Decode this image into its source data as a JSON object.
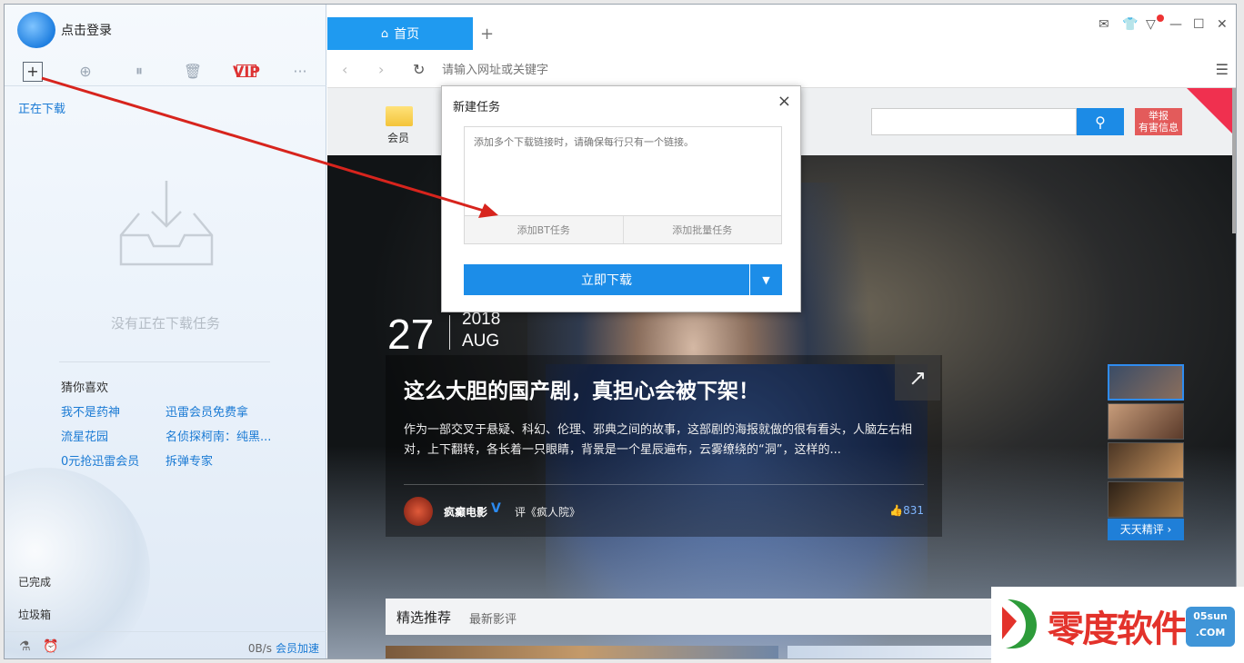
{
  "left": {
    "login": "点击登录",
    "toolbar": {
      "vip": "VIP",
      "more": "···"
    },
    "downloading": "正在下载",
    "empty": "没有正在下载任务",
    "guess_title": "猜你喜欢",
    "links": [
      "我不是药神",
      "迅雷会员免费拿",
      "流星花园",
      "名侦探柯南：纯黑...",
      "0元抢迅雷会员",
      "拆弹专家"
    ],
    "completed": "已完成",
    "trash": "垃圾箱",
    "speed": "0B/s",
    "accelerate": "会员加速"
  },
  "browser": {
    "tab_home": "首页",
    "tab_home_icon": "house-icon",
    "new_tab": "+",
    "address_placeholder": "请输入网址或关键字"
  },
  "page": {
    "nav_member": "会员",
    "report": [
      "举报",
      "有害信息"
    ],
    "date": {
      "day": "27",
      "year": "2018",
      "month": "AUG"
    },
    "headline": "这么大胆的国产剧，真担心会被下架！",
    "summary": "作为一部交叉于悬疑、科幻、伦理、邪典之间的故事，这部剧的海报就做的很有看头，人脑左右相对，上下翻转，各长着一只眼睛，背景是一个星辰遍布，云雾缭绕的“洞”，这样的...",
    "author": "疯癫电影",
    "review": "评《疯人院》",
    "likes": "831",
    "daily_pick": "天天精评 ›",
    "rec_title": "精选推荐",
    "rec_sub": "最新影评"
  },
  "dialog": {
    "title": "新建任务",
    "placeholder": "添加多个下载链接时，请确保每行只有一个链接。",
    "add_bt": "添加BT任务",
    "add_batch": "添加批量任务",
    "download_now": "立即下载"
  },
  "watermark": {
    "text": "零度软件园",
    "badge_top": "05sun",
    "badge_bottom": ".COM"
  }
}
